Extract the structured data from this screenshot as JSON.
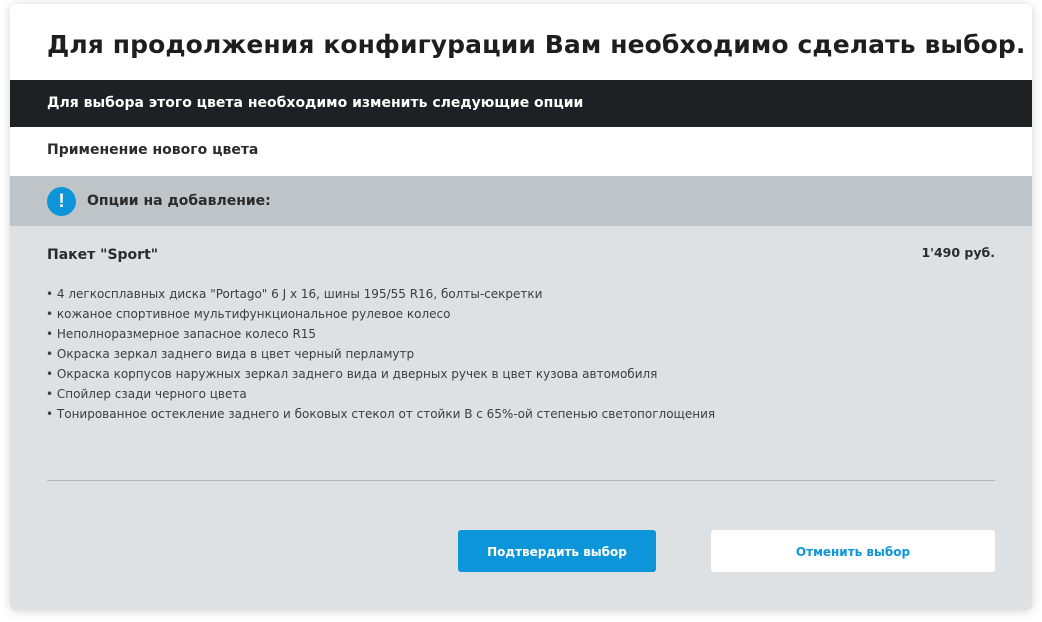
{
  "dialog": {
    "title": "Для продолжения конфигурации Вам необходимо сделать выбор.",
    "banner": "Для выбора этого цвета необходимо изменить следующие опции",
    "subtitle": "Применение нового цвета",
    "options_header": {
      "icon": "exclamation-icon",
      "icon_glyph": "!",
      "label": "Опции на добавление:"
    },
    "package": {
      "name": "Пакет \"Sport\"",
      "price": "1'490 руб.",
      "features": [
        "4 легкосплавных диска \"Portago\" 6 J x 16, шины 195/55 R16, болты-секретки",
        "кожаное спортивное мультифункциональное рулевое колесо",
        "Неполноразмерное запасное колесо R15",
        "Окраска зеркал заднего вида в цвет черный перламутр",
        "Окраска корпусов наружных зеркал заднего вида и дверных ручек в цвет кузова автомобиля",
        "Спойлер сзади черного цвета",
        "Тонированное остекление заднего и боковых стекол от стойки B с 65%-ой степенью светопоглощения"
      ]
    },
    "buttons": {
      "confirm": "Подтвердить выбор",
      "cancel": "Отменить выбор"
    }
  },
  "colors": {
    "accent": "#0c96d9",
    "banner_bg": "#1f2023",
    "options_header_bg": "#bfc4c8",
    "content_bg": "#dde1e4"
  }
}
